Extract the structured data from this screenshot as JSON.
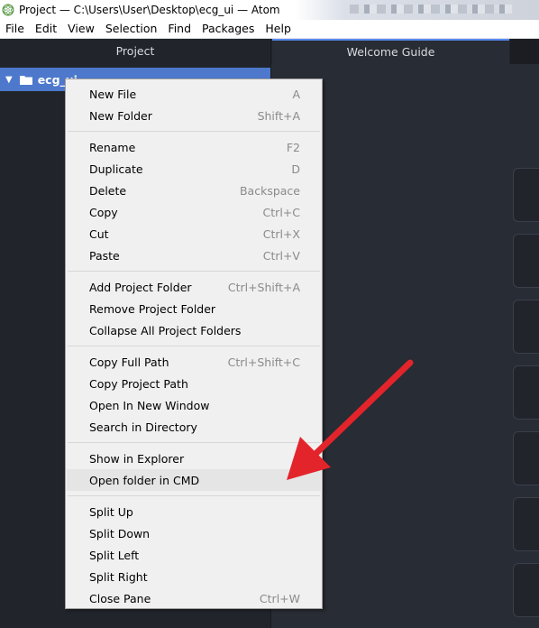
{
  "window": {
    "title": "Project — C:\\Users\\User\\Desktop\\ecg_ui — Atom"
  },
  "menubar": {
    "items": [
      "File",
      "Edit",
      "View",
      "Selection",
      "Find",
      "Packages",
      "Help"
    ]
  },
  "tabs": {
    "project": "Project",
    "welcome": "Welcome Guide"
  },
  "tree": {
    "root_label": "ecg_ui"
  },
  "context_menu": {
    "groups": [
      [
        {
          "label": "New File",
          "shortcut": "A"
        },
        {
          "label": "New Folder",
          "shortcut": "Shift+A"
        }
      ],
      [
        {
          "label": "Rename",
          "shortcut": "F2"
        },
        {
          "label": "Duplicate",
          "shortcut": "D"
        },
        {
          "label": "Delete",
          "shortcut": "Backspace"
        },
        {
          "label": "Copy",
          "shortcut": "Ctrl+C"
        },
        {
          "label": "Cut",
          "shortcut": "Ctrl+X"
        },
        {
          "label": "Paste",
          "shortcut": "Ctrl+V"
        }
      ],
      [
        {
          "label": "Add Project Folder",
          "shortcut": "Ctrl+Shift+A"
        },
        {
          "label": "Remove Project Folder",
          "shortcut": ""
        },
        {
          "label": "Collapse All Project Folders",
          "shortcut": ""
        }
      ],
      [
        {
          "label": "Copy Full Path",
          "shortcut": "Ctrl+Shift+C"
        },
        {
          "label": "Copy Project Path",
          "shortcut": ""
        },
        {
          "label": "Open In New Window",
          "shortcut": ""
        },
        {
          "label": "Search in Directory",
          "shortcut": ""
        }
      ],
      [
        {
          "label": "Show in Explorer",
          "shortcut": ""
        },
        {
          "label": "Open folder in CMD",
          "shortcut": "",
          "highlighted": true
        }
      ],
      [
        {
          "label": "Split Up",
          "shortcut": ""
        },
        {
          "label": "Split Down",
          "shortcut": ""
        },
        {
          "label": "Split Left",
          "shortcut": ""
        },
        {
          "label": "Split Right",
          "shortcut": ""
        },
        {
          "label": "Close Pane",
          "shortcut": "Ctrl+W"
        }
      ]
    ]
  },
  "colors": {
    "accent_blue": "#4d78cc",
    "tree_bg": "#21252b",
    "editor_bg": "#282c34",
    "menu_bg": "#f0f0f0",
    "arrow_red": "#e3242b"
  },
  "icons": {
    "app": "atom-icon",
    "folder": "folder-icon",
    "chevron": "chevron-down-icon",
    "annotation": "red-arrow-icon"
  }
}
